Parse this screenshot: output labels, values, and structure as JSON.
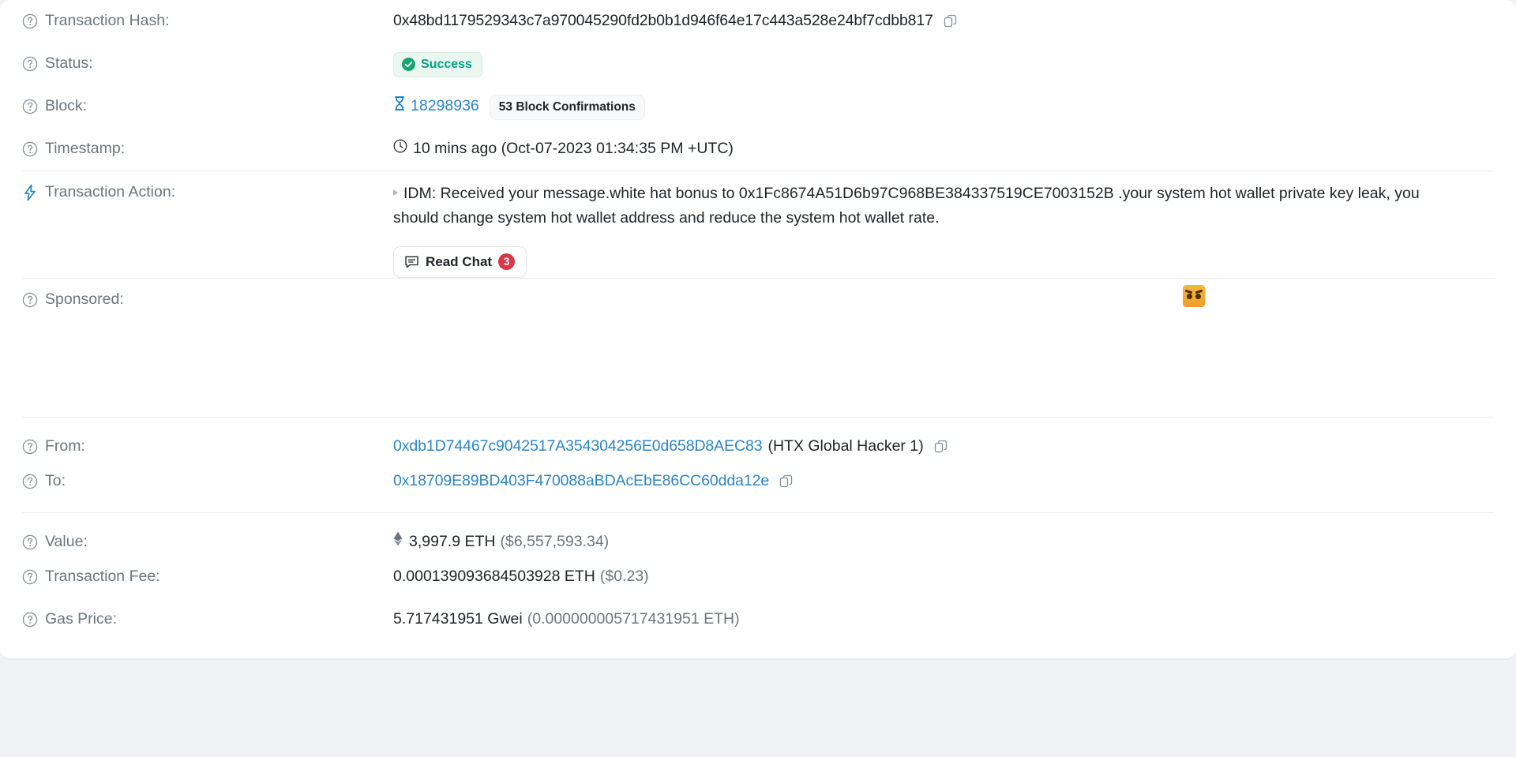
{
  "colors": {
    "link": "#2a85c9",
    "success": "#00a186",
    "success_bg": "#eaf7f0",
    "badge_red": "#dc3545",
    "label": "#6c757d",
    "text": "#212529",
    "page_bg": "#f0f2f5"
  },
  "rows": {
    "transaction_hash": {
      "label": "Transaction Hash:",
      "value": "0x48bd1179529343c7a970045290fd2b0b1d946f64e17c443a528e24bf7cdbb817",
      "copy_icon": "copy-icon",
      "help_icon": "help-circle-icon"
    },
    "status": {
      "label": "Status:",
      "value": "Success",
      "help_icon": "help-circle-icon",
      "status_icon": "check-circle-icon"
    },
    "block": {
      "label": "Block:",
      "number": "18298936",
      "confirmations": "53 Block Confirmations",
      "help_icon": "help-circle-icon",
      "block_icon": "hourglass-icon"
    },
    "timestamp": {
      "label": "Timestamp:",
      "value": "10 mins ago (Oct-07-2023 01:34:35 PM +UTC)",
      "help_icon": "help-circle-icon",
      "time_icon": "clock-icon"
    },
    "transaction_action": {
      "label": "Transaction Action:",
      "action_icon": "lightning-bolt-icon",
      "caret_icon": "caret-right-icon",
      "text": "IDM: Received your message.white hat bonus to 0x1Fc8674A51D6b97C968BE384337519CE7003152B .your system hot wallet private key leak, you should change system hot wallet address and reduce the system hot wallet rate.",
      "read_chat_label": "Read Chat",
      "read_chat_count": "3",
      "read_chat_icon": "chat-bubble-icon"
    },
    "sponsored": {
      "label": "Sponsored:",
      "help_icon": "help-circle-icon",
      "ad_icon": "angry-face-avatar"
    },
    "from": {
      "label": "From:",
      "address": "0xdb1D74467c9042517A354304256E0d658D8AEC83",
      "tag": "(HTX Global Hacker 1)",
      "help_icon": "help-circle-icon",
      "copy_icon": "copy-icon"
    },
    "to": {
      "label": "To:",
      "address": "0x18709E89BD403F470088aBDAcEbE86CC60dda12e",
      "help_icon": "help-circle-icon",
      "copy_icon": "copy-icon"
    },
    "value": {
      "label": "Value:",
      "amount": "3,997.9 ETH",
      "fiat": "($6,557,593.34)",
      "help_icon": "help-circle-icon",
      "currency_icon": "ethereum-diamond-icon"
    },
    "transaction_fee": {
      "label": "Transaction Fee:",
      "amount": "0.000139093684503928 ETH",
      "fiat": "($0.23)",
      "help_icon": "help-circle-icon"
    },
    "gas_price": {
      "label": "Gas Price:",
      "amount": "5.717431951 Gwei",
      "eth_equiv": "(0.000000005717431951 ETH)",
      "help_icon": "help-circle-icon"
    }
  }
}
